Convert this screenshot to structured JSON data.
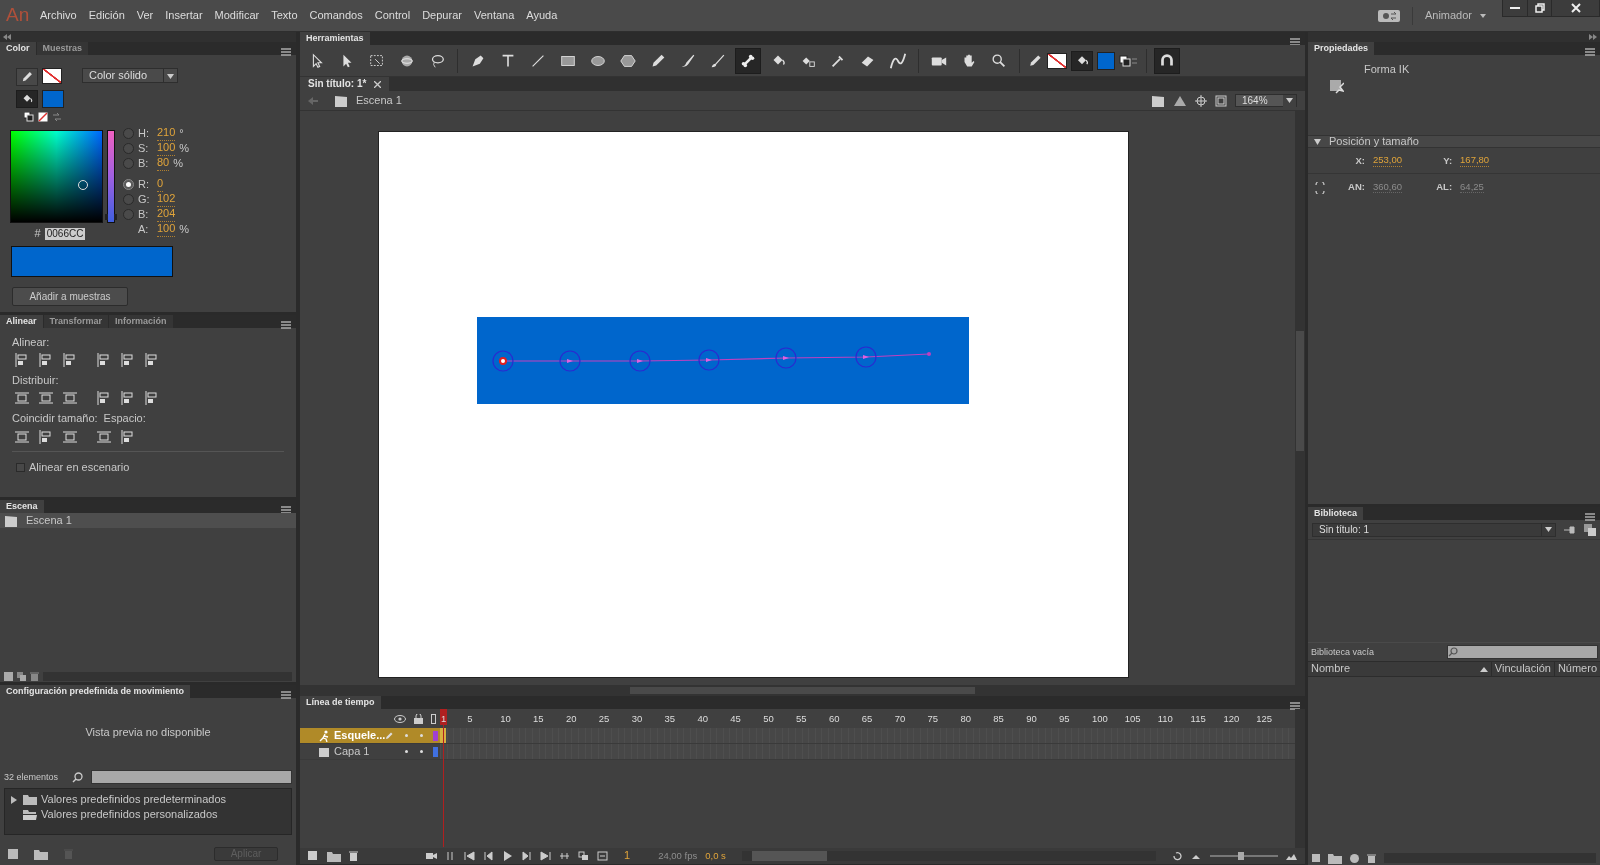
{
  "menu": {
    "logo": "An",
    "items": [
      "Archivo",
      "Edición",
      "Ver",
      "Insertar",
      "Modificar",
      "Texto",
      "Comandos",
      "Control",
      "Depurar",
      "Ventana",
      "Ayuda"
    ],
    "workspace": "Animador"
  },
  "color_panel": {
    "tabs": [
      {
        "label": "Color",
        "selected": true
      },
      {
        "label": "Muestras",
        "selected": false
      }
    ],
    "fill_type": "Color sólido",
    "field_groups": [
      [
        {
          "kind": "radio",
          "label": "H:",
          "value": "210",
          "unit": "°",
          "selected": false
        },
        {
          "kind": "radio",
          "label": "S:",
          "value": "100",
          "unit": "%",
          "selected": false
        },
        {
          "kind": "radio",
          "label": "B:",
          "value": "80",
          "unit": "%",
          "selected": false
        }
      ],
      [
        {
          "kind": "radio",
          "label": "R:",
          "value": "0",
          "selected": true
        },
        {
          "kind": "radio",
          "label": "G:",
          "value": "102",
          "selected": false
        },
        {
          "kind": "radio",
          "label": "B:",
          "value": "204",
          "selected": false
        },
        {
          "kind": "plain",
          "label": "A:",
          "value": "100",
          "unit": "%"
        }
      ]
    ],
    "hex_label": "#",
    "hex": "0066CC",
    "add_button": "Añadir a muestras"
  },
  "align_panel": {
    "tabs": [
      {
        "label": "Alinear",
        "selected": true
      },
      {
        "label": "Transformar",
        "selected": false
      },
      {
        "label": "Información",
        "selected": false
      }
    ],
    "sections": [
      {
        "kind": "align",
        "labels": [
          "Alinear:"
        ]
      },
      {
        "kind": "distribute",
        "labels": [
          "Distribuir:"
        ]
      },
      {
        "kind": "size",
        "labels": [
          "Coincidir tamaño:",
          "Espacio:"
        ]
      }
    ],
    "stage_option": {
      "label": "Alinear en escenario",
      "checked": false
    }
  },
  "scene_panel": {
    "tabs": [
      {
        "label": "Escena",
        "selected": true
      }
    ],
    "scenes": [
      {
        "name": "Escena 1",
        "selected": true
      }
    ]
  },
  "presets_panel": {
    "tabs": [
      {
        "label": "Configuración predefinida de movimiento",
        "selected": true
      }
    ],
    "preview": "Vista previa no disponible",
    "count": "32 elementos",
    "folders": [
      {
        "name": "Valores predefinidos predeterminados",
        "expandable": true
      },
      {
        "name": "Valores predefinidos personalizados",
        "expandable": false
      }
    ],
    "apply_button": "Aplicar",
    "apply_disabled": true
  },
  "tools_panel": {
    "tabs": [
      {
        "label": "Herramientas",
        "selected": true
      }
    ],
    "tools": [
      {
        "kind": "select",
        "selected": false
      },
      {
        "kind": "subselect",
        "selected": false
      },
      {
        "kind": "transform",
        "selected": false
      },
      {
        "kind": "rotate",
        "selected": false
      },
      {
        "kind": "lasso",
        "selected": false
      },
      {
        "kind": "separator"
      },
      {
        "kind": "pen",
        "selected": false
      },
      {
        "kind": "text",
        "selected": false
      },
      {
        "kind": "line",
        "selected": false
      },
      {
        "kind": "rect",
        "selected": false
      },
      {
        "kind": "oval",
        "selected": false
      },
      {
        "kind": "poly",
        "selected": false
      },
      {
        "kind": "pencil",
        "selected": false
      },
      {
        "kind": "paintbrush",
        "selected": false
      },
      {
        "kind": "brush",
        "selected": false
      },
      {
        "kind": "bone",
        "selected": true
      },
      {
        "kind": "bucket",
        "selected": false
      },
      {
        "kind": "ink",
        "selected": false
      },
      {
        "kind": "dropper",
        "selected": false
      },
      {
        "kind": "eraser",
        "selected": false
      },
      {
        "kind": "width",
        "selected": false
      },
      {
        "kind": "separator"
      },
      {
        "kind": "camera",
        "selected": false
      },
      {
        "kind": "hand",
        "selected": false
      },
      {
        "kind": "zoom",
        "selected": false
      },
      {
        "kind": "separator"
      },
      {
        "kind": "colors"
      },
      {
        "kind": "separator"
      },
      {
        "kind": "snap",
        "selected": true
      }
    ]
  },
  "document": {
    "tabs": [
      {
        "label": "Sin título: 1*",
        "selected": true
      }
    ],
    "scene": "Escena 1",
    "zoom": "164%"
  },
  "timeline": {
    "tabs": [
      {
        "label": "Línea de tiempo",
        "selected": true
      }
    ],
    "frame_numbers": [
      "1",
      "5",
      "10",
      "15",
      "20",
      "25",
      "30",
      "35",
      "40",
      "45",
      "50",
      "55",
      "60",
      "65",
      "70",
      "75",
      "80",
      "85",
      "90",
      "95",
      "100",
      "105",
      "110",
      "115",
      "120",
      "125"
    ],
    "layers": [
      {
        "kind": "armature",
        "name": "Esquele...",
        "selected": true,
        "color": "#a040d0"
      },
      {
        "kind": "layer",
        "name": "Capa 1",
        "selected": false,
        "color": "#4070e0"
      }
    ],
    "zoom_slider": {
      "level": 0.45
    },
    "current_frame": "1",
    "fps": "24,00 fps",
    "time": "0,0 s"
  },
  "properties": {
    "tabs": [
      {
        "label": "Propiedades",
        "selected": true
      }
    ],
    "object": "Forma IK",
    "section": "Posición y tamaño",
    "section_expanded": true,
    "fields": [
      {
        "label": "X:",
        "value": "253,00",
        "disabled": false
      },
      {
        "label": "Y:",
        "value": "167,80",
        "disabled": false
      },
      {
        "label": "AN:",
        "value": "360,60",
        "disabled": true
      },
      {
        "label": "AL:",
        "value": "64,25",
        "disabled": true
      }
    ]
  },
  "library": {
    "tabs": [
      {
        "label": "Biblioteca",
        "selected": true
      }
    ],
    "document": "Sin título: 1",
    "status": "Biblioteca vacía",
    "columns": [
      "Nombre",
      "Vinculación",
      "Número"
    ]
  }
}
